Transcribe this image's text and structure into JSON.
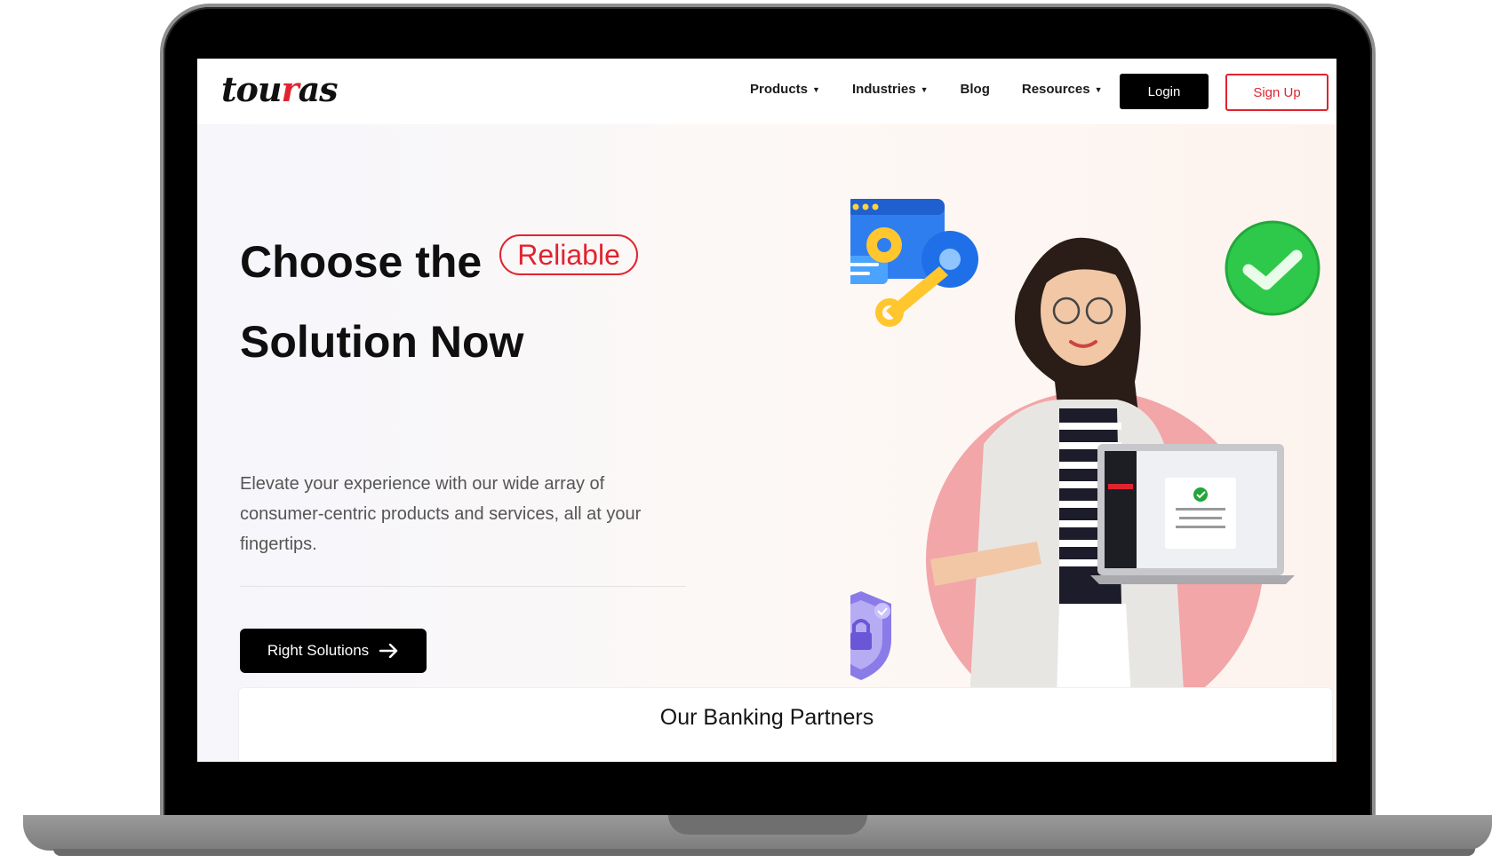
{
  "brand": {
    "logo_part1": "tou",
    "logo_accent": "r",
    "logo_part2": "as",
    "accent_color": "#e0242f"
  },
  "nav": {
    "items": [
      {
        "label": "Products",
        "dropdown": true
      },
      {
        "label": "Industries",
        "dropdown": true
      },
      {
        "label": "Blog",
        "dropdown": false
      },
      {
        "label": "Resources",
        "dropdown": true
      }
    ],
    "login_label": "Login",
    "signup_label": "Sign Up"
  },
  "hero": {
    "title_line1": "Choose the",
    "badge": "Reliable",
    "title_line2": "Solution Now",
    "description": "Elevate your experience with our wide array of consumer-centric products and services, all at your fingertips.",
    "cta_label": "Right Solutions"
  },
  "partners": {
    "title": "Our Banking Partners"
  },
  "icons": {
    "settings": "settings-window-icon",
    "check": "check-circle-icon",
    "security": "shield-lock-icon",
    "arrow": "arrow-right-icon"
  }
}
